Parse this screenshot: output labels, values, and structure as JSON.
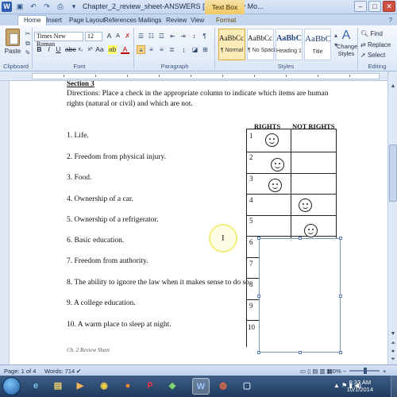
{
  "window": {
    "title": "Chapter_2_review_sheet-ANSWERS [Compatibility Mo...",
    "context_tab": "Text Box Tools",
    "app_icon": "W"
  },
  "ribbon_tabs": [
    "Home",
    "Insert",
    "Page Layout",
    "References",
    "Mailings",
    "Review",
    "View",
    "Format"
  ],
  "ribbon": {
    "clipboard": {
      "paste": "Paste",
      "group": "Clipboard"
    },
    "font": {
      "name": "Times New Roman",
      "size": "12",
      "group": "Font"
    },
    "paragraph": {
      "group": "Paragraph"
    },
    "styles": {
      "group": "Styles",
      "items": [
        {
          "preview": "AaBbCcI",
          "name": "¶ Normal"
        },
        {
          "preview": "AaBbCcI",
          "name": "¶ No Spaci..."
        },
        {
          "preview": "AaBbC",
          "name": "Heading 1"
        },
        {
          "preview": "AaBbC",
          "name": "Title"
        }
      ],
      "change_styles": "Change Styles"
    },
    "editing": {
      "find": "Find",
      "replace": "Replace",
      "select": "Select",
      "group": "Editing"
    }
  },
  "document": {
    "cut_heading": "Section 3",
    "directions": "Directions:  Place a check in the appropriate column to indicate which items are human rights (natural or civil) and which are not.",
    "col_rights": "RIGHTS",
    "col_not_rights": "NOT RIGHTS",
    "items": [
      "1.  Life.",
      "2.  Freedom from physical injury.",
      "3.  Food.",
      "4.  Ownership of a car.",
      "5.  Ownership of a refrigerator.",
      "6.  Basic education.",
      "7.  Freedom from authority.",
      "8.  The ability to ignore the law when it makes sense to do so.",
      "9.  A college education.",
      "10.  A warm place to sleep at night."
    ],
    "row_numbers": [
      "1",
      "2",
      "3",
      "4",
      "5",
      "6",
      "7",
      "8",
      "9",
      "10"
    ],
    "footer": "Ch. 2 Review Sheet"
  },
  "status_bar": {
    "page": "Page: 1 of 4",
    "words": "Words: 714",
    "zoom": "110%"
  },
  "taskbar": {
    "time": "8:33 AM",
    "date": "10/1/2014"
  }
}
